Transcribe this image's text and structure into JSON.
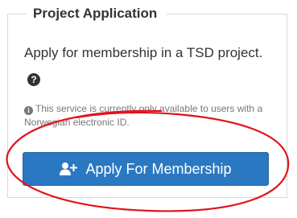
{
  "panel": {
    "legend": "Project Application",
    "description": "Apply for membership in a TSD project.",
    "help_icon_glyph": "?",
    "notice": "This service is currently only available to users with a Norwegian electronic ID.",
    "info_icon_glyph": "i"
  },
  "button": {
    "label": "Apply For Membership",
    "icon": "user-plus-icon"
  },
  "colors": {
    "button_bg": "#2b78c2",
    "annotation_red": "#e0141e",
    "text_primary": "#333333",
    "text_muted": "#777777",
    "border": "#d8d8d8"
  },
  "annotation": {
    "shape": "hand-drawn red ellipse circling the button"
  }
}
